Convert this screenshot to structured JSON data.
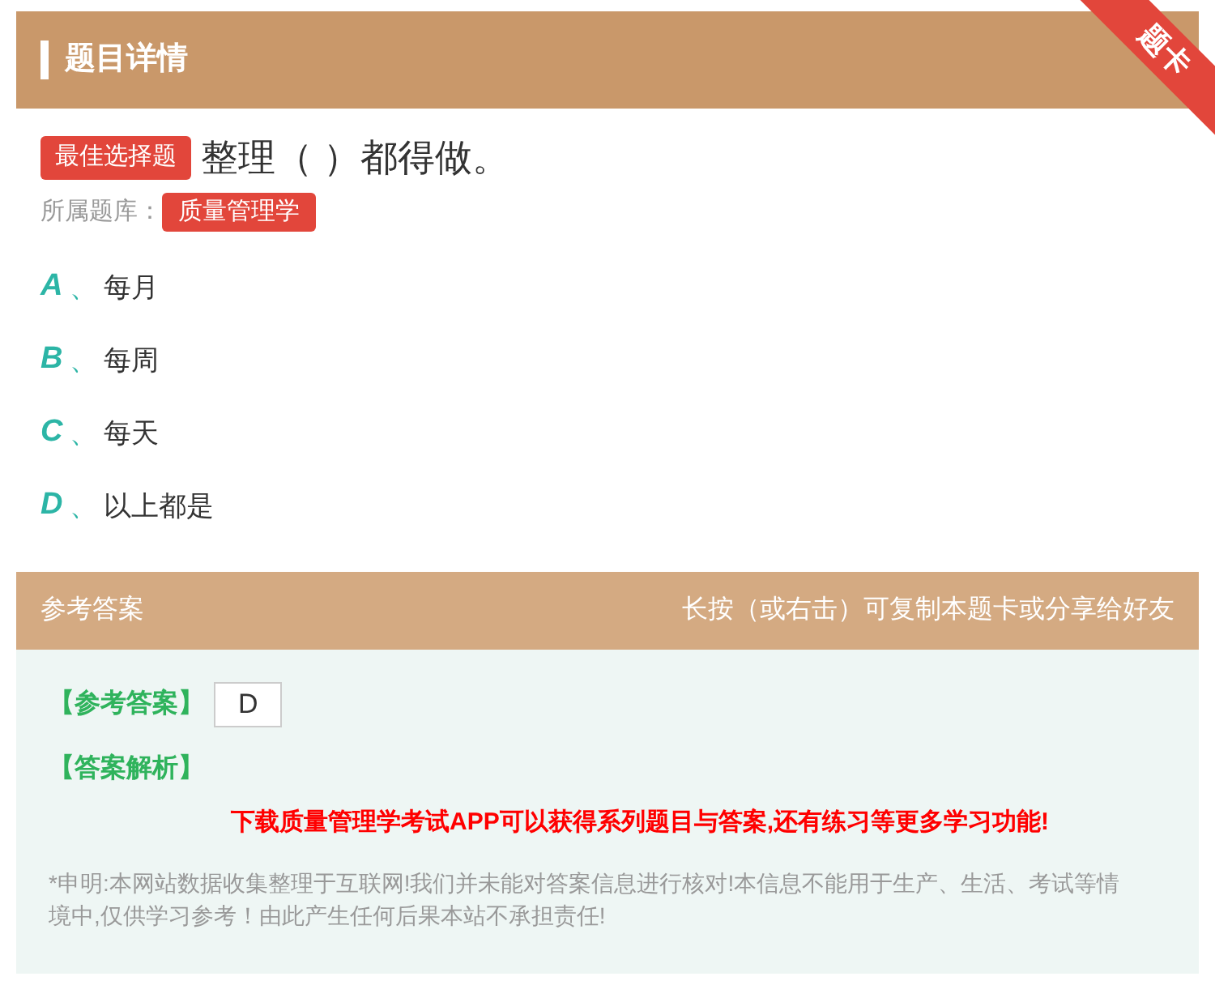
{
  "header": {
    "title": "题目详情",
    "ribbon": "题卡"
  },
  "question": {
    "type_badge": "最佳选择题",
    "text": "整理（ ）都得做。",
    "bank_label": "所属题库：",
    "bank": "质量管理学"
  },
  "options": [
    {
      "letter": "A",
      "sep": "、",
      "text": "每月"
    },
    {
      "letter": "B",
      "sep": "、",
      "text": "每周"
    },
    {
      "letter": "C",
      "sep": "、",
      "text": "每天"
    },
    {
      "letter": "D",
      "sep": "、",
      "text": "以上都是"
    }
  ],
  "answer_header": {
    "title": "参考答案",
    "hint": "长按（或右击）可复制本题卡或分享给好友"
  },
  "answer": {
    "label": "【参考答案】",
    "value": "D",
    "analysis_label": "【答案解析】",
    "promo": "下载质量管理学考试APP可以获得系列题目与答案,还有练习等更多学习功能!",
    "disclaimer": "*申明:本网站数据收集整理于互联网!我们并未能对答案信息进行核对!本信息不能用于生产、生活、考试等情境中,仅供学习参考！由此产生任何后果本站不承担责任!"
  }
}
